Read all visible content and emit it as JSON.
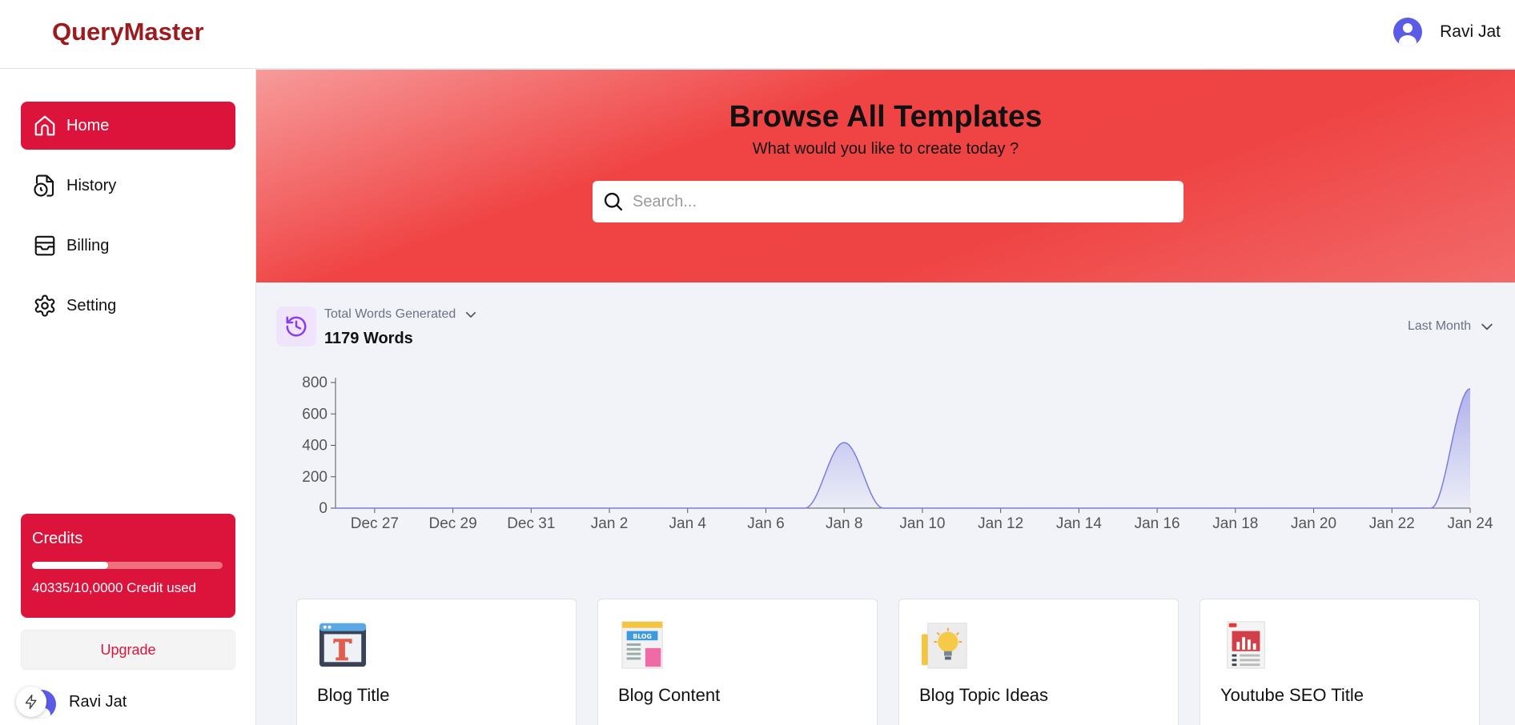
{
  "header": {
    "brand": "QueryMaster",
    "user_name": "Ravi Jat"
  },
  "sidebar": {
    "items": [
      {
        "label": "Home",
        "icon": "home-icon",
        "active": true
      },
      {
        "label": "History",
        "icon": "history-icon",
        "active": false
      },
      {
        "label": "Billing",
        "icon": "billing-icon",
        "active": false
      },
      {
        "label": "Setting",
        "icon": "gear-icon",
        "active": false
      }
    ],
    "credits": {
      "title": "Credits",
      "used_text": "40335/10,0000 Credit used",
      "progress_fraction": 0.4
    },
    "upgrade_label": "Upgrade",
    "user_name": "Ravi Jat"
  },
  "hero": {
    "title": "Browse All Templates",
    "subtitle": "What would you like to create today ?",
    "search_placeholder": "Search..."
  },
  "stats": {
    "label": "Total Words Generated",
    "value": "1179 Words",
    "range": "Last Month"
  },
  "chart_data": {
    "type": "area",
    "title": "",
    "xlabel": "",
    "ylabel": "",
    "ylim": [
      0,
      800
    ],
    "y_ticks": [
      0,
      200,
      400,
      600,
      800
    ],
    "x_ticks": [
      "Dec 27",
      "Dec 29",
      "Dec 31",
      "Jan 2",
      "Jan 4",
      "Jan 6",
      "Jan 8",
      "Jan 10",
      "Jan 12",
      "Jan 14",
      "Jan 16",
      "Jan 18",
      "Jan 20",
      "Jan 22",
      "Jan 24"
    ],
    "x": [
      "Dec 26",
      "Dec 27",
      "Dec 28",
      "Dec 29",
      "Dec 30",
      "Dec 31",
      "Jan 1",
      "Jan 2",
      "Jan 3",
      "Jan 4",
      "Jan 5",
      "Jan 6",
      "Jan 7",
      "Jan 8",
      "Jan 9",
      "Jan 10",
      "Jan 11",
      "Jan 12",
      "Jan 13",
      "Jan 14",
      "Jan 15",
      "Jan 16",
      "Jan 17",
      "Jan 18",
      "Jan 19",
      "Jan 20",
      "Jan 21",
      "Jan 22",
      "Jan 23",
      "Jan 24"
    ],
    "values": [
      0,
      0,
      0,
      0,
      0,
      0,
      0,
      0,
      0,
      0,
      0,
      0,
      0,
      418,
      0,
      0,
      0,
      0,
      0,
      0,
      0,
      0,
      0,
      0,
      0,
      0,
      0,
      0,
      0,
      761
    ],
    "grid": false,
    "color": "#7c7ce0"
  },
  "cards": [
    {
      "title": "Blog Title",
      "icon": "blog-title-icon"
    },
    {
      "title": "Blog Content",
      "icon": "blog-content-icon"
    },
    {
      "title": "Blog Topic Ideas",
      "icon": "lightbulb-icon"
    },
    {
      "title": "Youtube SEO Title",
      "icon": "youtube-seo-icon"
    }
  ]
}
